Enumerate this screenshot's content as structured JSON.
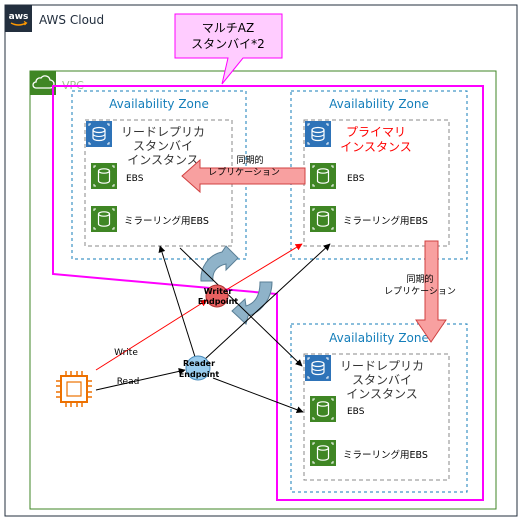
{
  "cloud": {
    "label": "AWS Cloud",
    "logo_text": "aws"
  },
  "vpc": {
    "label": "VPC"
  },
  "callout": {
    "line1": "マルチAZ",
    "line2": "スタンバイ*2"
  },
  "az_label": "Availability Zone",
  "instances": {
    "read_replica_top": {
      "line1": "リードレプリカ",
      "line2": "スタンバイ",
      "line3": "インスタンス"
    },
    "primary": {
      "line1": "プライマリ",
      "line2": "インスタンス"
    },
    "read_replica_bottom": {
      "line1": "リードレプリカ",
      "line2": "スタンバイ",
      "line3": "インスタンス"
    }
  },
  "ebs_label": "EBS",
  "mirror_ebs_label": "ミラーリング用EBS",
  "sync_replication": {
    "line1": "同期的",
    "line2": "レプリケーション"
  },
  "writer_endpoint": {
    "line1": "Writer",
    "line2": "Endpoint"
  },
  "reader_endpoint": {
    "line1": "Reader",
    "line2": "Endpoint"
  },
  "write_label": "Write",
  "read_label": "Read",
  "colors": {
    "az_border": "#147eba",
    "az_text": "#147eba",
    "vpc_border": "#3f8624",
    "magenta": "#ff00ff",
    "callout_fill": "#ffccff",
    "rds_blue": "#2e73b8",
    "ebs_green": "#3f8624",
    "primary_red": "#ff0000",
    "sync_arrow_fill": "#f8a0a0",
    "writer_fill": "#e86060",
    "reader_fill": "#99ccee",
    "failover_fill": "#8fb3c9",
    "ec2_orange": "#ed7100"
  }
}
